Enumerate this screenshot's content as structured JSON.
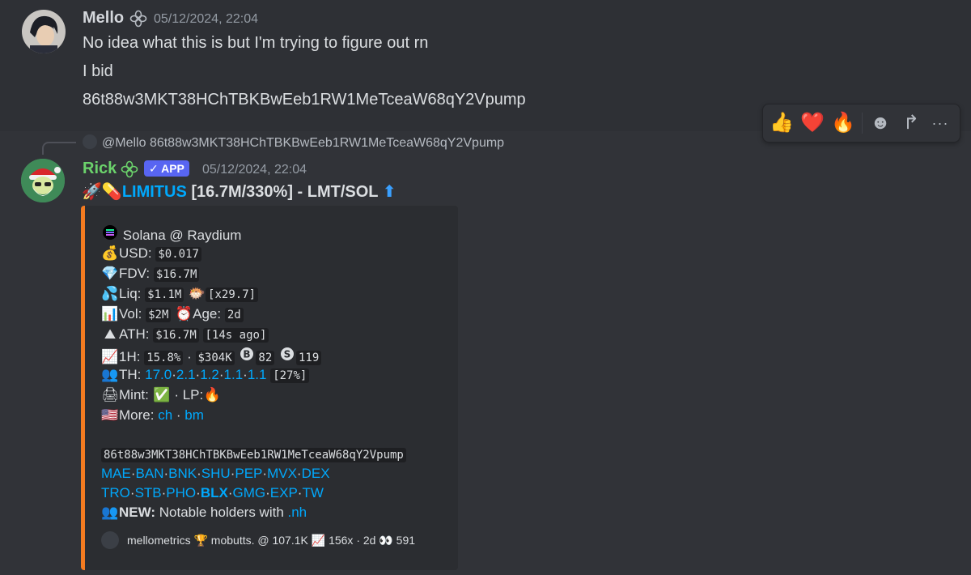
{
  "message1": {
    "author": "Mello",
    "timestamp": "05/12/2024, 22:04",
    "lines": [
      "No idea what this is but I'm trying to figure out rn",
      "I bid",
      "86t88w3MKT38HChTBKBwEeb1RW1MeTceaW68qY2Vpump"
    ]
  },
  "toolbar": {
    "items": [
      "👍",
      "❤️",
      "🔥",
      "☻",
      "↱",
      "···"
    ]
  },
  "reply": {
    "mention": "@Mello",
    "text": "86t88w3MKT38HChTBKBwEeb1RW1MeTceaW68qY2Vpump"
  },
  "message2": {
    "author": "Rick",
    "badge": "✓ APP",
    "timestamp": "05/12/2024, 22:04",
    "headline_emoji": "🚀💊",
    "headline_link": "LIMITUS",
    "headline_rest": " [16.7M/330%] - LMT/SOL ",
    "headline_arrow": "⬆"
  },
  "embed": {
    "chain": "Solana @ Raydium",
    "usd_label": "USD:",
    "usd": "$0.017",
    "fdv_label": "FDV:",
    "fdv": "$16.7M",
    "liq_label": "Liq:",
    "liq": "$1.1M",
    "liq_mult": "[x29.7]",
    "vol_label": "Vol:",
    "vol": "$2M",
    "age_label": "Age:",
    "age": "2d",
    "ath_label": "ATH:",
    "ath": "$16.7M",
    "ath_when": "[14s ago]",
    "h1_label": "1H:",
    "h1_pct": "15.8%",
    "h1_sep": "·",
    "h1_vol": "$304K",
    "h1_buys": "82",
    "h1_sells": "119",
    "th_label": "TH:",
    "th_values": [
      "17.0",
      "2.1",
      "1.2",
      "1.1",
      "1.1"
    ],
    "th_total": "[27%]",
    "mint_label": "Mint:",
    "lp_label": "· LP:",
    "more_label": "More:",
    "more_links": [
      "ch",
      "bm"
    ],
    "address": "86t88w3MKT38HChTBKBwEeb1RW1MeTceaW68qY2Vpump",
    "links_row1": [
      "MAE",
      "BAN",
      "BNK",
      "SHU",
      "PEP",
      "MVX",
      "DEX"
    ],
    "links_row2": [
      "TRO",
      "STB",
      "PHO",
      "BLX",
      "GMG",
      "EXP",
      "TW"
    ],
    "new_label": "NEW:",
    "new_text": " Notable holders with ",
    "new_cmd": ".nh",
    "footer_user": "mellometrics",
    "footer_text": "mobutts. @ 107.1K",
    "footer_stats": "156x · 2d",
    "footer_views": "591"
  },
  "colors": {
    "background": "#313338",
    "hover_row": "#2e3035",
    "embed_bg": "#2b2d31",
    "embed_accent": "#f47b20",
    "link": "#00a8fc",
    "rick_name": "#6bd26b",
    "app_badge": "#5865f2"
  }
}
